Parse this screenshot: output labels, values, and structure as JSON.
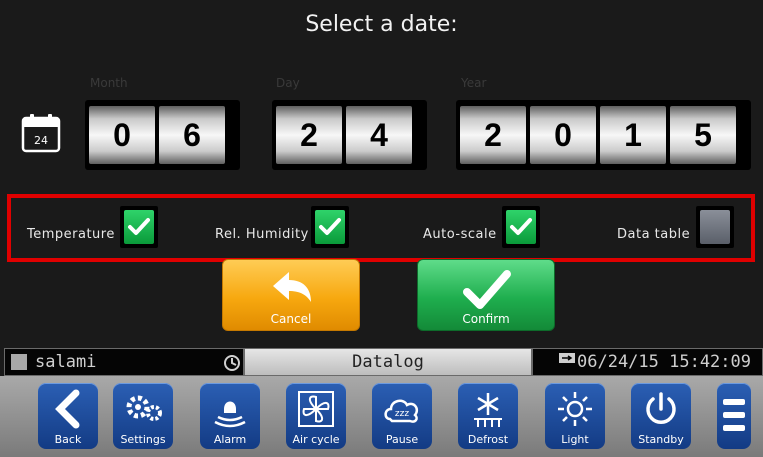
{
  "title": "Select a date:",
  "date": {
    "month_label": "Month",
    "day_label": "Day",
    "year_label": "Year",
    "calendar_day": "24",
    "month_digits": [
      "0",
      "6"
    ],
    "day_digits": [
      "2",
      "4"
    ],
    "year_digits": [
      "2",
      "0",
      "1",
      "5"
    ]
  },
  "options": {
    "temperature": {
      "label": "Temperature",
      "checked": true
    },
    "humidity": {
      "label": "Rel. Humidity",
      "checked": true
    },
    "autoscale": {
      "label": "Auto-scale",
      "checked": true
    },
    "datatable": {
      "label": "Data table",
      "checked": false
    }
  },
  "buttons": {
    "cancel": "Cancel",
    "confirm": "Confirm"
  },
  "status": {
    "device": "salami",
    "screen": "Datalog",
    "datetime": "06/24/15 15:42:09"
  },
  "toolbar": {
    "back": "Back",
    "settings": "Settings",
    "alarm": "Alarm",
    "aircycle": "Air cycle",
    "pause": "Pause",
    "defrost": "Defrost",
    "light": "Light",
    "standby": "Standby"
  },
  "colors": {
    "highlight": "#e00000",
    "check": "#1fb84f",
    "cancel": "#f7a80f",
    "confirm": "#1fae4e",
    "toolbar_button": "#1f4ea0"
  }
}
